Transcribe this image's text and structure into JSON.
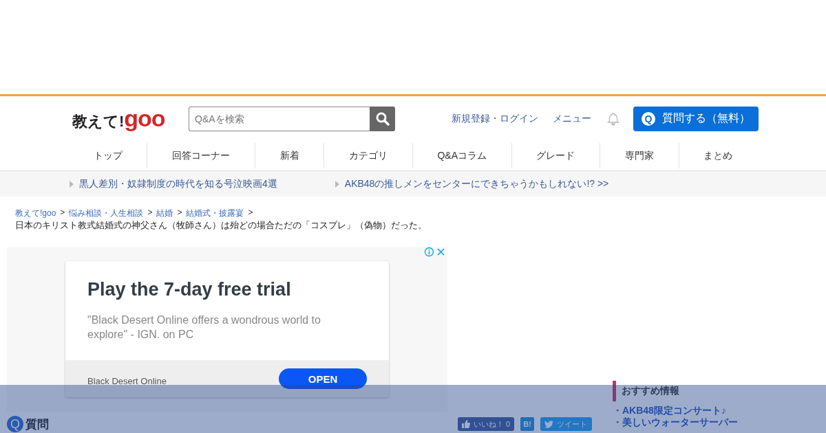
{
  "header": {
    "logo_prefix": "教えて!",
    "logo_brand": "goo",
    "search": {
      "placeholder": "Q&Aを検索"
    },
    "links": [
      "新規登録・ログイン",
      "メニュー"
    ],
    "ask_button": {
      "icon": "Q",
      "label": "質問する（無料）"
    }
  },
  "nav": [
    {
      "label": "トップ"
    },
    {
      "label": "回答コーナー"
    },
    {
      "label": "新着"
    },
    {
      "label": "カテゴリ"
    },
    {
      "label": "Q&Aコラム"
    },
    {
      "label": "グレード"
    },
    {
      "label": "専門家"
    },
    {
      "label": "まとめ"
    }
  ],
  "pickups": [
    "黒人差別・奴隷制度の時代を知る号泣映画4選",
    "AKB48の推しメンをセンターにできちゃうかもしれない!? >>"
  ],
  "breadcrumb": [
    "教えて!goo",
    "悩み相談・人生相談",
    "結婚",
    "結婚式・披露宴"
  ],
  "breadcrumb_sep": ">",
  "page_title": "日本のキリスト教式結婚式の神父さん（牧師さん）は殆どの場合ただの「コスプレ」（偽物）だった。",
  "ad": {
    "headline": "Play the 7-day free trial",
    "body": "\"Black Desert Online offers a wondrous world to explore\" - IGN. on PC",
    "advertiser": "Black Desert Online",
    "cta": "OPEN"
  },
  "question": {
    "icon": "Q",
    "heading": "質問",
    "like": "いいね！",
    "like_count": "0",
    "hatena": "B!",
    "tweet": "ツイート"
  },
  "recommend": {
    "heading": "おすすめ情報",
    "items": [
      "・AKB48限定コンサート♪",
      "・美しいウォーターサーバー"
    ]
  }
}
